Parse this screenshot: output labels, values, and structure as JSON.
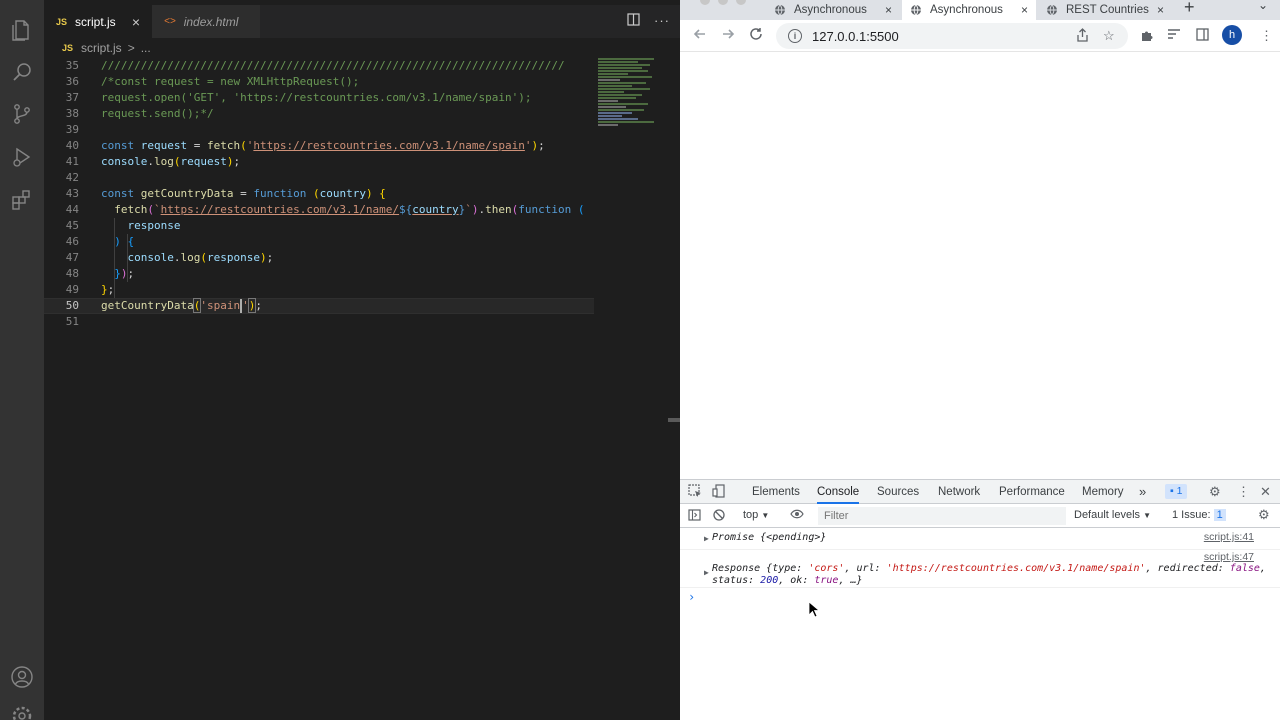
{
  "vscode": {
    "activity_icons": [
      "files-icon",
      "search-icon",
      "source-control-icon",
      "run-debug-icon",
      "extensions-icon",
      "account-icon",
      "settings-icon"
    ],
    "tabs": [
      {
        "badge": "JS",
        "label": "script.js",
        "close": "×"
      },
      {
        "badge": "<>",
        "label": "index.html"
      }
    ],
    "breadcrumb": {
      "badge": "JS",
      "file": "script.js",
      "sep": ">",
      "rest": "..."
    },
    "line_numbers": [
      "35",
      "36",
      "37",
      "38",
      "39",
      "40",
      "41",
      "42",
      "43",
      "44",
      "45",
      "46",
      "47",
      "48",
      "49",
      "50",
      "51"
    ],
    "code": {
      "l35": "//////////////////////////////////////////////////////////////////////",
      "l36": "/*const request = new XMLHttpRequest();",
      "l37": "request.open('GET', 'https://restcountries.com/v3.1/name/spain');",
      "l38": "request.send();*/",
      "l40_kw": "const ",
      "l40_var": "request",
      "l40_eq": " = ",
      "l40_fn": "fetch",
      "l40_p1": "(",
      "l40_q1": "'",
      "l40_url": "https://restcountries.com/v3.1/name/spain",
      "l40_q2": "'",
      "l40_p2": ")",
      "l40_end": ";",
      "l41_var": "console",
      "l41_dot": ".",
      "l41_fn": "log",
      "l41_p1": "(",
      "l41_arg": "request",
      "l41_p2": ")",
      "l41_end": ";",
      "l43_kw": "const ",
      "l43_fn": "getCountryData",
      "l43_eq": " = ",
      "l43_kw2": "function ",
      "l43_p1": "(",
      "l43_arg": "country",
      "l43_p2": ")",
      "l43_br": " {",
      "l44_fn": "fetch",
      "l44_p1": "(",
      "l44_bt": "`",
      "l44_url": "https://restcountries.com/v3.1/name/",
      "l44_tpl1": "${",
      "l44_tvar": "country",
      "l44_tpl2": "}",
      "l44_bt2": "`",
      "l44_p2": ")",
      "l44_dot": ".",
      "l44_then": "then",
      "l44_p3": "(",
      "l44_kw": "function ",
      "l44_p4": "(",
      "l45_arg": "response",
      "l46_p": ") ",
      "l46_br": "{",
      "l47_var": "console",
      "l47_dot": ".",
      "l47_fn": "log",
      "l47_p1": "(",
      "l47_arg": "response",
      "l47_p2": ")",
      "l47_end": ";",
      "l48_br": "}",
      "l48_p": ")",
      "l48_end": ";",
      "l49_br": "}",
      "l49_end": ";",
      "l50_fn": "getCountryData",
      "l50_p1": "(",
      "l50_str1": "'spain",
      "l50_str2": "'",
      "l50_p2": ")",
      "l50_end": ";"
    }
  },
  "chrome": {
    "tabs": [
      {
        "label": "Asynchronous",
        "close": "×"
      },
      {
        "label": "Asynchronous",
        "close": "×"
      },
      {
        "label": "REST Countries",
        "close": "×"
      }
    ],
    "new_tab": "+",
    "tab_menu": "⌄",
    "url": "127.0.0.1:5500",
    "avatar_letter": "h",
    "devtools": {
      "tabs": [
        "Elements",
        "Console",
        "Sources",
        "Network",
        "Performance",
        "Memory"
      ],
      "more": "»",
      "issues_count": "1",
      "context": "top",
      "filter_placeholder": "Filter",
      "levels": "Default levels",
      "issue_label": "1 Issue:",
      "issue_count": "1",
      "console": {
        "row1_src": "script.js:41",
        "row1_text": "Promise {<pending>}",
        "row2_src": "script.js:47",
        "row2_head": "Response {type: ",
        "row2_type": "'cors'",
        "row2_mid": ", url: ",
        "row2_url": "'https://restcountries.com/v3.1/name/spain'",
        "row2_redir": ", redirected: ",
        "row2_false": "false",
        "row2_comma": ",",
        "row2_status": "status: ",
        "row2_200": "200",
        "row2_ok": ", ok: ",
        "row2_true": "true",
        "row2_tail": ", …}",
        "prompt": "›"
      }
    },
    "colors": {
      "accent": "#1a73e8",
      "string": "#c41a16",
      "number": "#1a1aa6",
      "keyword": "#881280"
    }
  }
}
